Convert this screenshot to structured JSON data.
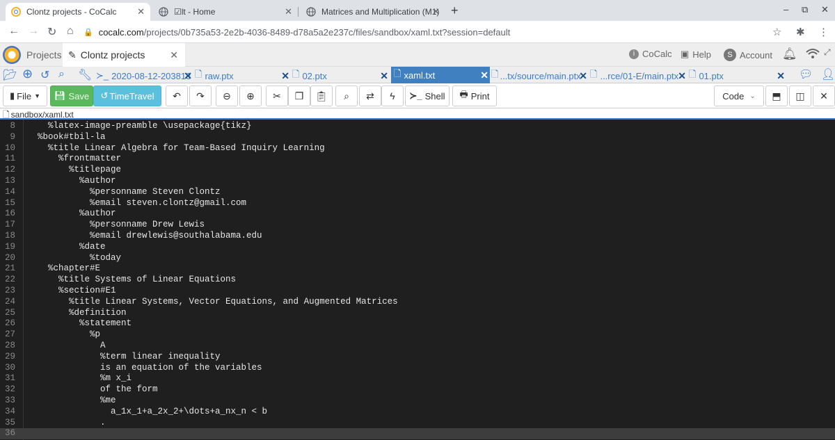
{
  "browser": {
    "tabs": [
      {
        "title": "Clontz projects - CoCalc",
        "active": true
      },
      {
        "title": "☑lt - Home",
        "active": false
      },
      {
        "title": "Matrices and Multiplication (M1)",
        "active": false
      }
    ],
    "new_tab": "+",
    "window_controls": [
      "–",
      "⧉",
      "✕"
    ],
    "url_host": "cocalc.com",
    "url_path": "/projects/0b735a53-2e2b-4036-8489-d78a5a2e237c/files/sandbox/xaml.txt?session=default"
  },
  "cocalc": {
    "projects_label": "Projects",
    "project_tab": "Clontz projects",
    "cocalc_label": "CoCalc",
    "help_label": "Help",
    "account_label": "Account",
    "account_initial": "S"
  },
  "file_tabs": [
    {
      "label": "2020-08-12-203813",
      "active": false
    },
    {
      "label": "raw.ptx",
      "active": false
    },
    {
      "label": "02.ptx",
      "active": false
    },
    {
      "label": "xaml.txt",
      "active": true
    },
    {
      "label": "...tx/source/main.ptx",
      "active": false
    },
    {
      "label": "...rce/01-E/main.ptx",
      "active": false
    },
    {
      "label": "01.ptx",
      "active": false
    }
  ],
  "toolbar": {
    "file_label": "File",
    "save_label": "Save",
    "timetravel_label": "TimeTravel",
    "shell_label": "Shell",
    "print_label": "Print",
    "mode_label": "Code"
  },
  "path": "sandbox/xaml.txt",
  "editor": {
    "lines": [
      {
        "n": "8",
        "text": "    %latex-image-preamble \\usepackage{tikz}"
      },
      {
        "n": "9",
        "text": "  %book#tbil-la"
      },
      {
        "n": "10",
        "text": "    %title Linear Algebra for Team-Based Inquiry Learning"
      },
      {
        "n": "11",
        "text": "      %frontmatter"
      },
      {
        "n": "12",
        "text": "        %titlepage"
      },
      {
        "n": "13",
        "text": "          %author"
      },
      {
        "n": "14",
        "text": "            %personname Steven Clontz"
      },
      {
        "n": "15",
        "text": "            %email steven.clontz@gmail.com"
      },
      {
        "n": "16",
        "text": "          %author"
      },
      {
        "n": "17",
        "text": "            %personname Drew Lewis"
      },
      {
        "n": "18",
        "text": "            %email drewlewis@southalabama.edu"
      },
      {
        "n": "19",
        "text": "          %date"
      },
      {
        "n": "20",
        "text": "            %today"
      },
      {
        "n": "21",
        "text": "    %chapter#E"
      },
      {
        "n": "22",
        "text": "      %title Systems of Linear Equations"
      },
      {
        "n": "23",
        "text": "      %section#E1"
      },
      {
        "n": "24",
        "text": "        %title Linear Systems, Vector Equations, and Augmented Matrices"
      },
      {
        "n": "25",
        "text": "        %definition"
      },
      {
        "n": "26",
        "text": "          %statement"
      },
      {
        "n": "27",
        "text": "            %p"
      },
      {
        "n": "28",
        "text": "              A"
      },
      {
        "n": "29",
        "text": "              %term linear inequality"
      },
      {
        "n": "30",
        "text": "              is an equation of the variables"
      },
      {
        "n": "31",
        "text": "              %m x_i"
      },
      {
        "n": "32",
        "text": "              of the form"
      },
      {
        "n": "33",
        "text": "              %me"
      },
      {
        "n": "34",
        "text": "                a_1x_1+a_2x_2+\\dots+a_nx_n < b"
      },
      {
        "n": "35",
        "text": "              ."
      },
      {
        "n": "36",
        "text": ""
      }
    ],
    "current_line": "36"
  }
}
